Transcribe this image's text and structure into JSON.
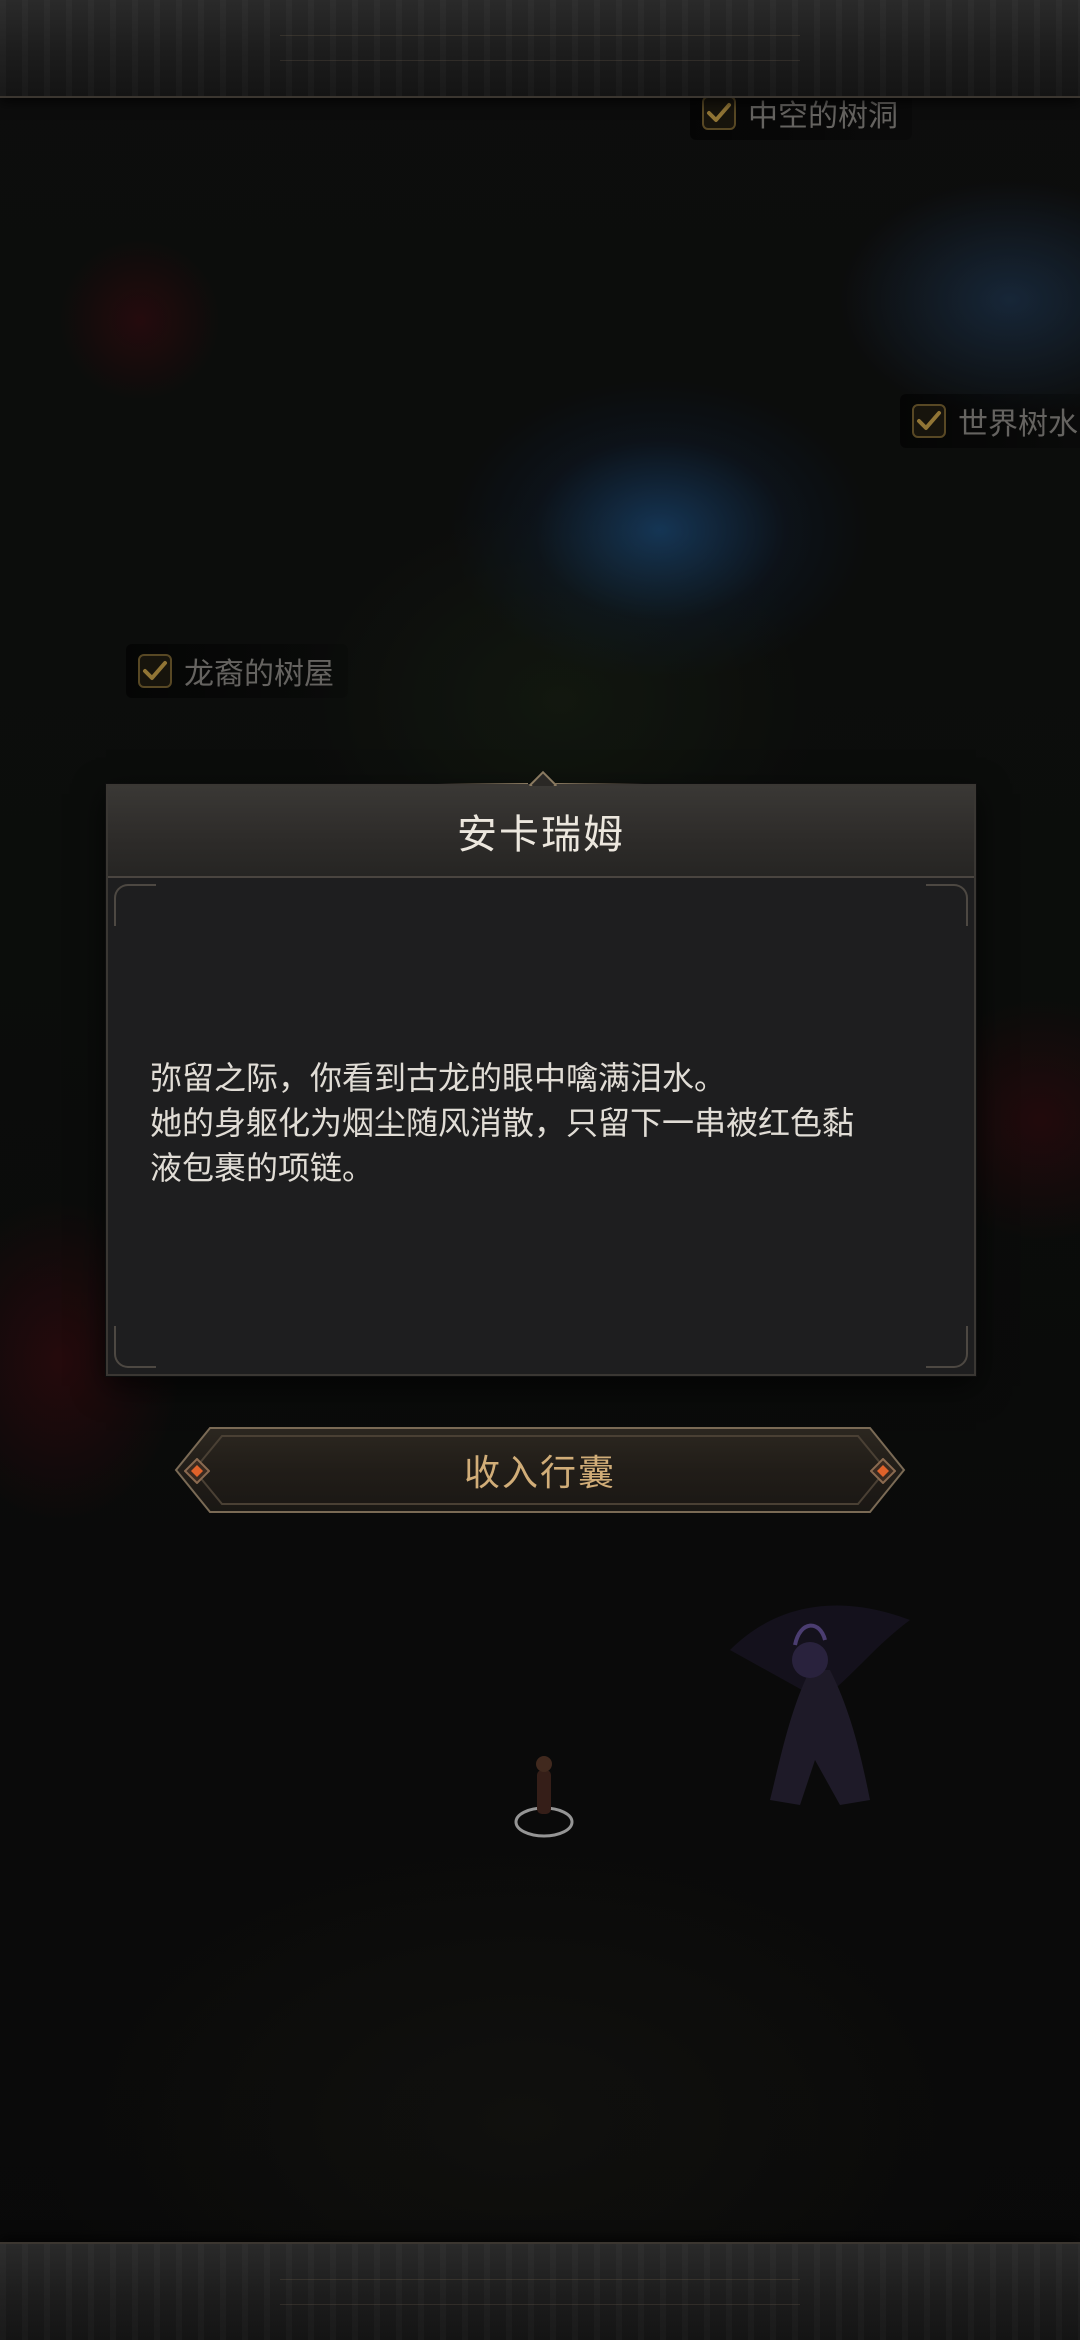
{
  "map": {
    "locations": [
      {
        "label": "中空的树洞",
        "icon": "checkmark-icon"
      },
      {
        "label": "世界树水",
        "icon": "checkmark-icon"
      },
      {
        "label": "龙裔的树屋",
        "icon": "checkmark-icon"
      }
    ]
  },
  "dialog": {
    "title": "安卡瑞姆",
    "body_lines": [
      "弥留之际，你看到古龙的眼中噙满泪水。",
      "她的身躯化为烟尘随风消散，只留下一串被红色黏",
      "液包裹的项链。"
    ]
  },
  "action_button": {
    "label": "收入行囊"
  },
  "colors": {
    "accent_gold": "#d1ad78",
    "check_gold": "#c9a24a",
    "panel_bg": "#1e1e1f",
    "ember": "#e0622a"
  }
}
